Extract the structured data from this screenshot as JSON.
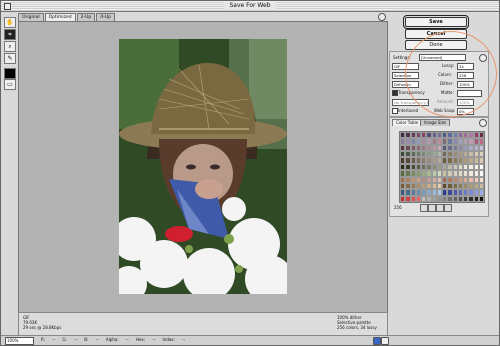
{
  "window": {
    "title": "Save For Web"
  },
  "tabs": [
    {
      "label": "Original"
    },
    {
      "label": "Optimized",
      "active": true
    },
    {
      "label": "2-Up"
    },
    {
      "label": "4-Up"
    }
  ],
  "tools": [
    {
      "name": "hand-tool-icon",
      "glyph": "✋"
    },
    {
      "name": "slice-select-tool-icon",
      "glyph": "⌗"
    },
    {
      "name": "zoom-tool-icon",
      "glyph": "🔍"
    },
    {
      "name": "eyedropper-tool-icon",
      "glyph": "✎"
    },
    {
      "name": "toggle-slices-icon",
      "glyph": "▭"
    }
  ],
  "buttons": {
    "save": "Save",
    "cancel": "Cancel",
    "done": "Done"
  },
  "settings": {
    "label": "Settings:",
    "preset": "[Unnamed]",
    "format": "GIF",
    "lossy_label": "Lossy:",
    "lossy_value": "34",
    "palette": "Selective",
    "colors_label": "Colors:",
    "colors_value": "256",
    "dither_algorithm": "Diffusion",
    "dither_label": "Dither:",
    "dither_value": "100%",
    "transparency_label": "Transparency",
    "matte_label": "Matte:",
    "no_transparency_dither": "No Transparency Dither",
    "amount_label": "Amount:",
    "amount_value": "100%",
    "interlaced_label": "Interlaced",
    "web_snap_label": "Web Snap:",
    "web_snap_value": "0%"
  },
  "color_table": {
    "tabs": [
      {
        "label": "Color Table"
      },
      {
        "label": "Image Size"
      }
    ],
    "count": "256",
    "colors": [
      "#3a2a3c",
      "#4e3550",
      "#6a3a5a",
      "#7c4a6a",
      "#8a3d63",
      "#5b4d7a",
      "#6a5f8a",
      "#7a6a9a",
      "#4b5b8a",
      "#5a6aa0",
      "#6e7ab0",
      "#8a6aa0",
      "#a06a9a",
      "#b07aa0",
      "#903a60",
      "#6a2a40",
      "#8a7a9a",
      "#9a8aaa",
      "#7a8aaa",
      "#8a9ab8",
      "#aa8aa0",
      "#b09aaa",
      "#a07a8a",
      "#c08aa0",
      "#7a6a7a",
      "#6a7a9a",
      "#8a8ab0",
      "#a0a0c0",
      "#b0a0b0",
      "#c0a0b0",
      "#aa5a7a",
      "#c06a8a",
      "#5a3a4a",
      "#6a4a5a",
      "#7a5a6a",
      "#8a6a7a",
      "#9a7a8a",
      "#aa8a9a",
      "#ba9aaa",
      "#caaaba",
      "#5a5a7a",
      "#6a6a8a",
      "#7a7a9a",
      "#8a8aaa",
      "#9a9aba",
      "#aaaaca",
      "#bab0d0",
      "#cac0d8",
      "#3a4a3a",
      "#4a5a4a",
      "#5a6a5a",
      "#6a7a6a",
      "#7a8a7a",
      "#8a9a8a",
      "#9aaa9a",
      "#aabaaa",
      "#7a6a5a",
      "#8a7a6a",
      "#9a8a7a",
      "#aa9a8a",
      "#baaa9a",
      "#cabaaa",
      "#dacaba",
      "#e0d0c0",
      "#4a3a2a",
      "#5a4a3a",
      "#6a5a4a",
      "#7a6a5a",
      "#8a7a6a",
      "#9a8a7a",
      "#aa9a8a",
      "#baaa9a",
      "#6a5a3a",
      "#7a6a4a",
      "#8a7a5a",
      "#9a8a6a",
      "#aa9a7a",
      "#baaa8a",
      "#cabb9a",
      "#dacaaa",
      "#2a2a1a",
      "#3a3a2a",
      "#4a4a3a",
      "#5a5a4a",
      "#6a6a5a",
      "#7a7a6a",
      "#8a8a7a",
      "#9a9a8a",
      "#aaaa9a",
      "#babaaa",
      "#cacaba",
      "#dadaca",
      "#eaeada",
      "#f0f0e0",
      "#f6f6ee",
      "#ffffff",
      "#5a6a3a",
      "#6a7a4a",
      "#7a8a5a",
      "#8a9a6a",
      "#9aaa7a",
      "#aaba8a",
      "#bacaaa",
      "#cadaba",
      "#c8c0a0",
      "#d0c8b0",
      "#d8d0c0",
      "#e0d8c8",
      "#e8e0d0",
      "#f0e8d8",
      "#f4eee4",
      "#fafaf4",
      "#a07050",
      "#b08060",
      "#c09070",
      "#d0a080",
      "#b09080",
      "#c0a090",
      "#d0b0a0",
      "#e0c0b0",
      "#a06a50",
      "#b07a60",
      "#c08a70",
      "#d09a80",
      "#e0aa90",
      "#e8bca8",
      "#f0ccbc",
      "#f8dcd0",
      "#7a5a3a",
      "#8a6a4a",
      "#9a7a5a",
      "#aa8a6a",
      "#ba9a7a",
      "#caaa8a",
      "#dabb9a",
      "#eacbaa",
      "#5a4a2a",
      "#6a5a3a",
      "#7a6a4a",
      "#8a7a5a",
      "#9a8a6a",
      "#aa9a7a",
      "#baaa8a",
      "#cabb9a",
      "#3a5a7a",
      "#4a6a8a",
      "#5a7a9a",
      "#6a8aaa",
      "#7a9aba",
      "#8aaaca",
      "#9abada",
      "#aacaea",
      "#2a3a8a",
      "#3a4a9a",
      "#4a5aaa",
      "#5a6aba",
      "#6a7aca",
      "#7a8ada",
      "#8a9ae0",
      "#9aaae8",
      "#c03030",
      "#d04040",
      "#e05050",
      "#f06060",
      "#c0c0c0",
      "#b0b0b0",
      "#a0a0a0",
      "#909090",
      "#808080",
      "#707070",
      "#606060",
      "#505050",
      "#404040",
      "#303030",
      "#202020",
      "#101010"
    ]
  },
  "status": {
    "left_line1": "GIF",
    "left_line2": "79.03K",
    "left_line3": "29 sec @ 28.8Kbps",
    "right_line1": "100% dither",
    "right_line2": "Selective palette",
    "right_line3": "256 colors, 34 lossy"
  },
  "bottom": {
    "zoom": "100%",
    "readouts": "R: -- G: -- B: -- Alpha: -- Hex: -- Index: --"
  },
  "colors": {
    "annotation_circle": "#e9976c"
  }
}
